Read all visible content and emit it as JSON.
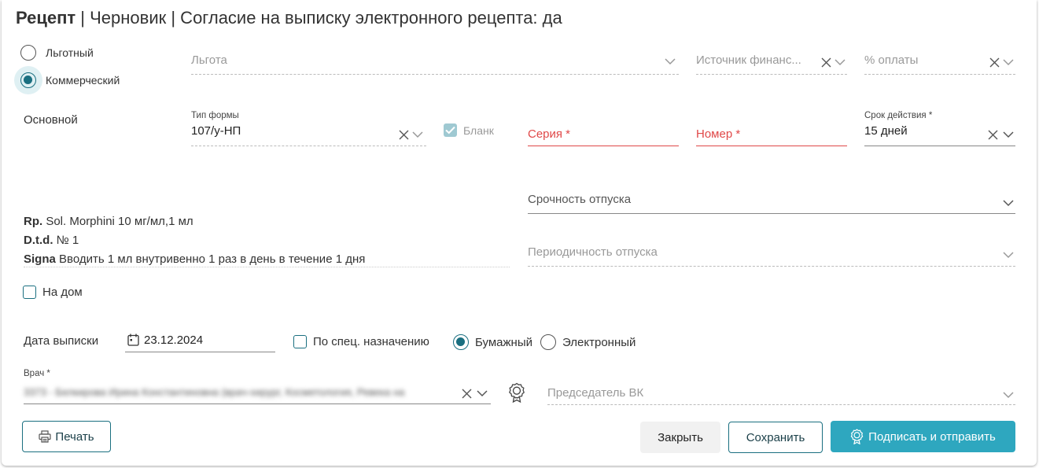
{
  "header": {
    "title_bold": "Рецепт",
    "title_rest": " | Черновик | Согласие на выписку электронного рецепта: да"
  },
  "type_radios": {
    "preferential_label": "Льготный",
    "commercial_label": "Коммерческий",
    "selected": "commercial"
  },
  "top_fields": {
    "benefit_placeholder": "Льгота",
    "funding_placeholder": "Источник финанс...",
    "payment_placeholder": "% оплаты"
  },
  "main_section": {
    "label": "Основной",
    "form_type_label": "Тип формы",
    "form_type_value": "107/у-НП",
    "blank_label": "Бланк",
    "blank_checked": true,
    "series_placeholder": "Серия *",
    "number_placeholder": "Номер *",
    "validity_label": "Срок действия *",
    "validity_value": "15 дней"
  },
  "prescription": {
    "rp_prefix": "Rp.",
    "rp_text": " Sol. Morphini 10 мг/мл,1 мл",
    "dtd_prefix": "D.t.d.",
    "dtd_text": " № 1",
    "signa_prefix": "Signa",
    "signa_text": " Вводить 1 мл внутривенно 1 раз в день в течение 1 дня"
  },
  "dispense": {
    "urgency_placeholder": "Срочность отпуска",
    "periodicity_placeholder": "Периодичность отпуска"
  },
  "home": {
    "label": "На дом",
    "checked": false
  },
  "issue": {
    "date_label": "Дата выписки",
    "date_value": "23.12.2024",
    "special_label": "По спец. назначению",
    "special_checked": false,
    "paper_label": "Бумажный",
    "electronic_label": "Электронный",
    "format_selected": "paper"
  },
  "doctor": {
    "label": "Врач *",
    "value": "3373 - Белкирова Ирина Константиновна (врач-хирург, Косметология, Ревека на"
  },
  "commission": {
    "chair_placeholder": "Председатель ВК"
  },
  "footer": {
    "print_label": "Печать",
    "close_label": "Закрыть",
    "save_label": "Сохранить",
    "sign_label": "Подписать и отправить"
  },
  "colors": {
    "accent": "#1a6f80",
    "primary_button": "#2ea7bf",
    "error": "#e04848"
  }
}
